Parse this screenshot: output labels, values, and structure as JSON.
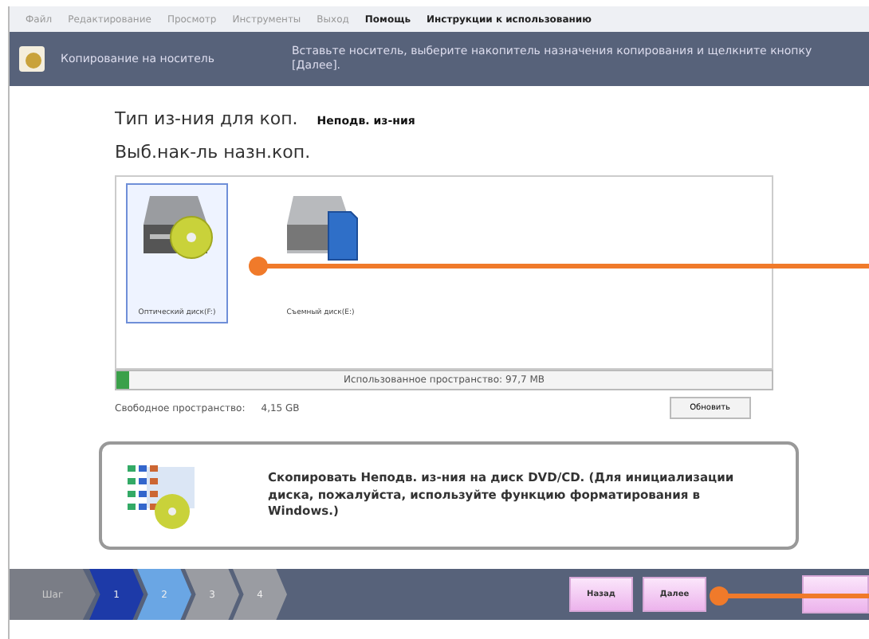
{
  "menu": [
    {
      "label": "Файл",
      "bold": false
    },
    {
      "label": "Редактирование",
      "bold": false
    },
    {
      "label": "Просмотр",
      "bold": false
    },
    {
      "label": "Инструменты",
      "bold": false
    },
    {
      "label": "Выход",
      "bold": false
    },
    {
      "label": "Помощь",
      "bold": true
    },
    {
      "label": "Инструкции к использованию",
      "bold": true
    }
  ],
  "header": {
    "title": "Копирование на носитель",
    "instruction": "Вставьте носитель, выберите накопитель назначения копирования и щелкните кнопку [Далее]."
  },
  "media_type": {
    "label": "Тип из-ния для коп.",
    "value": "Неподв. из-ния"
  },
  "drive_prompt": "Выб.нак-ль назн.коп.",
  "drives": [
    {
      "kind": "optical",
      "label": "Оптический диск(F:)",
      "selected": true
    },
    {
      "kind": "removable",
      "label": "Съемный диск(E:)",
      "selected": false
    }
  ],
  "usage": {
    "level": 0.02,
    "reading": "Использованное пространство: 97,7 MB"
  },
  "free_space": {
    "label": "Свободное пространство:",
    "value": "4,15 GB"
  },
  "refresh_button": "Обновить",
  "info": "Скопировать Неподв. из-ния на диск DVD/CD. (Для инициализации диска, пожалуйста, используйте функцию форматирования в Windows.)",
  "steps_label": "Шаг",
  "steps": [
    {
      "label": "1",
      "done": true,
      "selected": false
    },
    {
      "label": "2",
      "done": false,
      "selected": true
    },
    {
      "label": "3",
      "done": false,
      "selected": false
    },
    {
      "label": "4",
      "done": false,
      "selected": false
    }
  ],
  "buttons": [
    "Назад",
    "Далее"
  ]
}
